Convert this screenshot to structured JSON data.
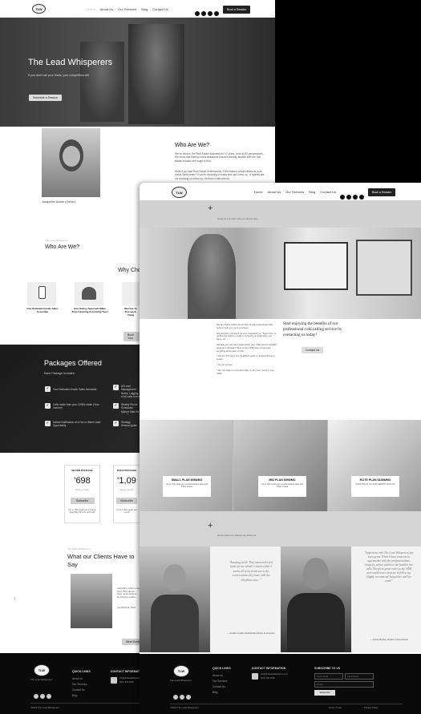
{
  "back": {
    "nav": {
      "home": "Home",
      "about": "About Us",
      "services": "Our Services",
      "blog": "Blog",
      "contact": "Contact Us",
      "cta": "Book a Session"
    },
    "hero": {
      "title": "The Lead Whisperers",
      "subtitle": "If you don't call your leads, your competition will.",
      "button": "Schedule a Session"
    },
    "about": {
      "caption": "Jacqueline Uriarte (Owner)",
      "title": "Who Are We?",
      "p1": "We've been in the Real Estate Business for 17 years, from all 50 perspectives. We know that finding unreal assistants that are actually familiar with the real estate industry are tough to find.",
      "p2": "What if you had Real Estate Professional, CRM-trained virtual callers as your Inside Sales team? If you're drowning in leads and can't keep up, or agents are not focusing on follow up, it's time to talk with us."
    },
    "who2": {
      "eyebrow": "The Lead Whisperers",
      "title": "Who Are We?"
    },
    "why": {
      "title": "Why Cho",
      "cards": [
        {
          "label": "One Dedicated Inside Sales Associate"
        },
        {
          "label": "Non-Salesy Approach Make Time Listening & Growing Trust"
        },
        {
          "label": "We Fine Tu Prospecti Clung"
        }
      ],
      "button": "Book Your"
    },
    "packages": {
      "title": "Packages Offered",
      "sub": "Each Package Includes:",
      "items": [
        "Your Dedicated Inside Sales Associate",
        "Calls made from your CRM's dialer (Your number)",
        "Instant Notification of a Hot or Warm Lead Opportunity",
        "All Lead Management Notes, Logging of all calls to the right Lead Fields in CRM",
        "Weekly Phone Schedules Market Stats for Your Business",
        "Strategy Session goals for the month"
      ]
    },
    "pricing": [
      {
        "name": "SILVER PACKAGE",
        "price": "698",
        "period": "Every month",
        "button": "Subscribe",
        "note": "Up to 700 Leads per month & Everyday Mon-Fri until sold"
      },
      {
        "name": "GOLD PACKAGE",
        "price": "1,09",
        "period": "Every month",
        "button": "Subscribe",
        "note": "Up to 1,300 Leads per month"
      }
    ],
    "clients": {
      "eyebrow": "The Lead Whisperers",
      "title": "What our Clients Have to Say",
      "quote": "Jacqueline Uriarte is the bomb. She has her finger on the pulse of the Phoenix market...",
      "name": "Lexi Richards, Real Estate Agent",
      "button": "Meet Some Clients"
    },
    "footer": {
      "logo_text": "The Lead Whisperers",
      "quick": "QUICK LINKS",
      "links": [
        "About us",
        "Our Services",
        "Contact Us",
        "Blog"
      ],
      "contact": "CONTACT INFORMATION",
      "email": "info@theleadwhisperers.com",
      "phone": "(602) 402-9730",
      "copy": "©2023 The Lead Whisperers"
    }
  },
  "front": {
    "nav": {
      "home": "Home",
      "about": "About Us",
      "services": "Our Services",
      "blog": "Blog",
      "contact": "Contact Us",
      "cta": "Book a Session"
    },
    "banner": "Listen to our calls with our clients here",
    "intro": {
      "paragraphs": [
        "We are highly skilled virtual ISAs & sales associates that work to help you more promises.",
        "We prioritize ourselves as your \"Assistant\" or \"Team One\" to update the seller's contact of property & Leadmates you have, etc.",
        "We dial your dormant leads within your CRM and fan EVERY dead and old leads! Most of the CRM sites incorporate recycling at the rate of 60%.",
        "* We do NOT Give Pre-Qualified Leads or Expired/Divorce Leads",
        "* No set up fees",
        "* We can listen to recorded calls, to all of our notes in your CRM"
      ],
      "headline": "Start enjoying the benefits of our professional cold calling service by contacting us today!",
      "button": "Contact Us"
    },
    "plans": [
      {
        "title": "SMALL PLAN $598/MO",
        "desc": "Up to 700 credit per month/includes New and Older Leads"
      },
      {
        "title": "MID PLAN $998/MO",
        "desc": "Up to 900 credit per month/includes New and Older Leads"
      },
      {
        "title": "ELITE PLAN $1898/MO",
        "desc": "FAST TRACK UP & PAYMENTS NOW ON"
      }
    ],
    "strip": "Here's what our clients say about us",
    "testimonials": [
      {
        "quote": "\"Amazing work! They answered a few leads for me which I closed within 3 weeks all of my leads are in the conversations they have with the telephone now...\"",
        "author": "— Amado Cavallo, Real Estate Advisor at Compass"
      },
      {
        "quote": "\"Inspection with The Lead Whisperers has been great. When I have someone in agreements with the professionalism, integrity, advice and how she handles her calls. She gives great notes so my CRM and would never drop me to follow up. Highly recommend Jacqueline and her team!\"",
        "author": "— Joshua Bentley, Realtor at HomeSmart"
      }
    ],
    "footer": {
      "logo_text": "The Lead Whisperers",
      "quick": "QUICK LINKS",
      "links": [
        "About us",
        "Our Services",
        "Contact Us",
        "Blog"
      ],
      "contact": "CONTACT INFORMATION",
      "email": "info@theleadwhisperers.com",
      "phone": "(602) 402-9730",
      "subscribe": "SUBSCRIBE TO US",
      "first": "First name",
      "last": "Last name",
      "email_ph": "Email",
      "button": "Subscribe",
      "copy": "©2023 The Lead Whisperers",
      "terms": "Terms of use",
      "privacy": "Privacy Policy"
    }
  }
}
